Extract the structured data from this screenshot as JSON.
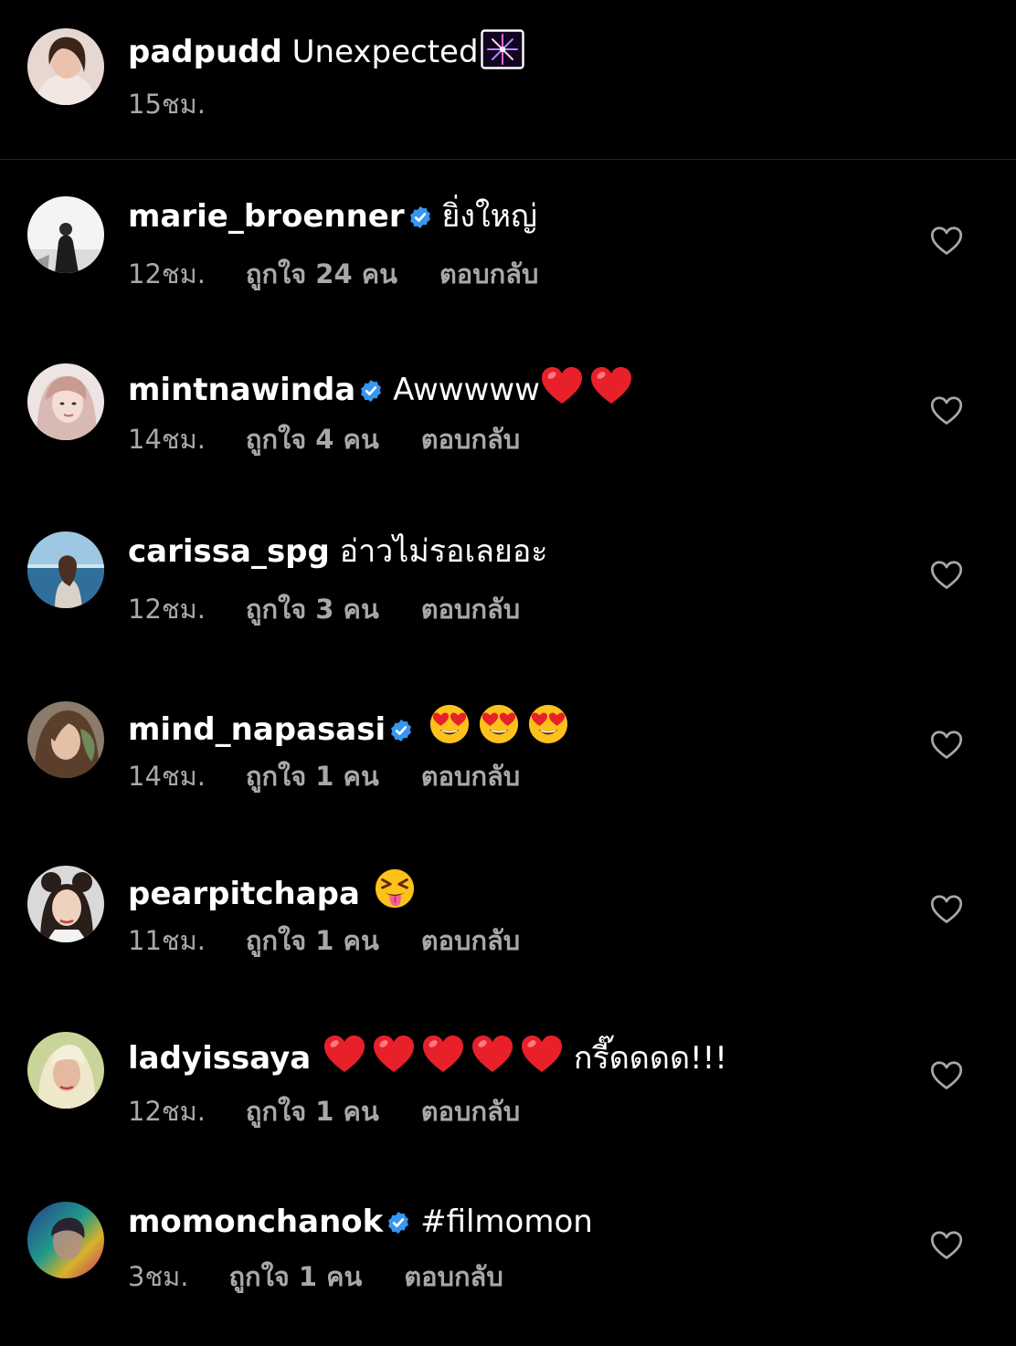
{
  "caption": {
    "username": "padpudd",
    "text": "Unexpected",
    "emoji": "firework",
    "time": "15ชม."
  },
  "comments": [
    {
      "username": "marie_broenner",
      "verified": true,
      "text": "ยิ่งใหญ่",
      "time": "12ชม.",
      "likes": "ถูกใจ 24 คน",
      "reply": "ตอบกลับ"
    },
    {
      "username": "mintnawinda",
      "verified": true,
      "text": "Awwwww",
      "emojis": [
        "red-heart",
        "red-heart"
      ],
      "time": "14ชม.",
      "likes": "ถูกใจ 4 คน",
      "reply": "ตอบกลับ"
    },
    {
      "username": "carissa_spg",
      "verified": false,
      "text": "อ่าวไม่รอเลยอะ",
      "time": "12ชม.",
      "likes": "ถูกใจ 3 คน",
      "reply": "ตอบกลับ"
    },
    {
      "username": "mind_napasasi",
      "verified": true,
      "text": "",
      "emojis": [
        "heart-eyes",
        "heart-eyes",
        "heart-eyes"
      ],
      "time": "14ชม.",
      "likes": "ถูกใจ 1 คน",
      "reply": "ตอบกลับ"
    },
    {
      "username": "pearpitchapa",
      "verified": false,
      "text": "",
      "emojis": [
        "squinting-tongue"
      ],
      "time": "11ชม.",
      "likes": "ถูกใจ 1 คน",
      "reply": "ตอบกลับ"
    },
    {
      "username": "ladyissaya",
      "verified": false,
      "text": "กรี๊ดดดด!!!",
      "emojis": [
        "red-heart",
        "red-heart",
        "red-heart",
        "red-heart",
        "red-heart"
      ],
      "time": "12ชม.",
      "likes": "ถูกใจ 1 คน",
      "reply": "ตอบกลับ"
    },
    {
      "username": "momonchanok",
      "verified": true,
      "text": "#filmomon",
      "time": "3ชม.",
      "likes": "ถูกใจ 1 คน",
      "reply": "ตอบกลับ"
    }
  ],
  "colors": {
    "background": "#000000",
    "text": "#ffffff",
    "secondary_text": "#a8a8a8",
    "verified_badge": "#3797f0",
    "divider": "#262626",
    "heart_outline": "#a8a8a8",
    "red_heart": "#e8202a"
  },
  "icons": {
    "verified": "verified-badge-icon",
    "like": "heart-outline-icon"
  }
}
